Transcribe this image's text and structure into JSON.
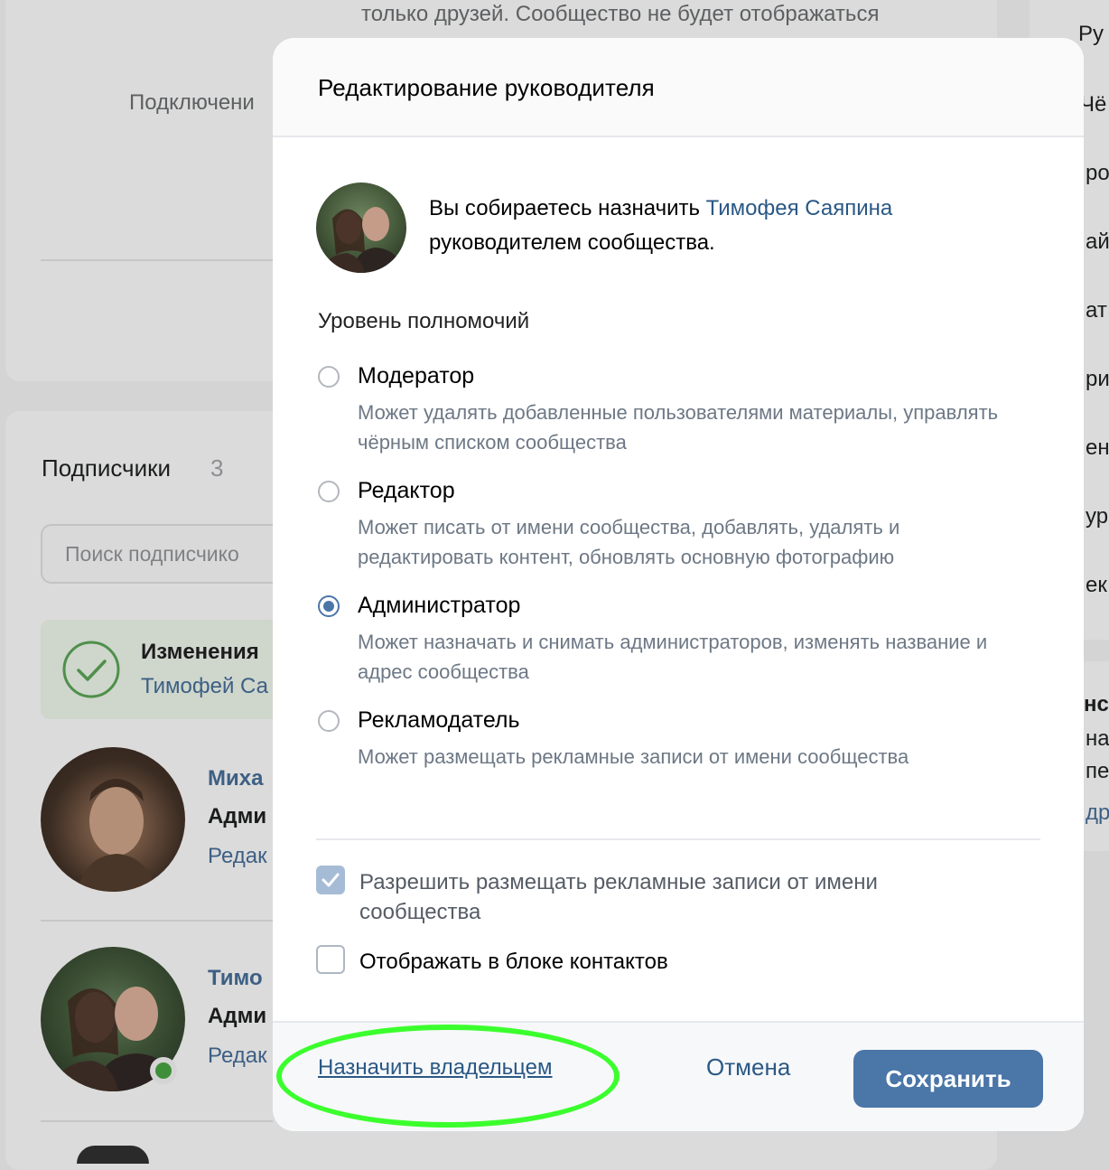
{
  "background": {
    "top_text": "только друзей. Сообщество не будет отображаться",
    "connect_label": "Подключени",
    "subscribers_title": "Подписчики",
    "subscribers_count": "3",
    "search_placeholder": "Поиск подписчико",
    "notice_title": "Изменения",
    "notice_name": "Тимофей Са",
    "members": [
      {
        "name": "Миха",
        "role": "Адми",
        "action": "Редак"
      },
      {
        "name": "Тимо",
        "role": "Адми",
        "action": "Редак"
      }
    ],
    "right_fragments": [
      "Ру",
      "Чё",
      "ро",
      "ай",
      "ат",
      "ри",
      "ен",
      "ур",
      "ек",
      "нс",
      "на",
      "пе",
      "др"
    ]
  },
  "modal": {
    "title": "Редактирование руководителя",
    "intro_prefix": "Вы собираетесь назначить ",
    "intro_name": "Тимофея Саяпина",
    "intro_suffix": "руководителем сообщества.",
    "permission_title": "Уровень полномочий",
    "options": [
      {
        "label": "Модератор",
        "desc": "Может удалять добавленные пользователями материалы, управлять чёрным списком сообщества",
        "checked": false
      },
      {
        "label": "Редактор",
        "desc": "Может писать от имени сообщества, добавлять, удалять и редактировать контент, обновлять основную фотографию",
        "checked": false
      },
      {
        "label": "Администратор",
        "desc": "Может назначать и снимать администраторов, изменять название и адрес сообщества",
        "checked": true
      },
      {
        "label": "Рекламодатель",
        "desc": "Может размещать рекламные записи от имени сообщества",
        "checked": false
      }
    ],
    "checkboxes": [
      {
        "label": "Разрешить размещать рекламные записи от имени сообщества",
        "checked": true,
        "disabled": true
      },
      {
        "label": "Отображать в блоке контактов",
        "checked": false,
        "disabled": false
      }
    ],
    "footer": {
      "owner_link": "Назначить владельцем",
      "cancel": "Отмена",
      "save": "Сохранить"
    }
  },
  "colors": {
    "accent": "#4a76a8",
    "link": "#2a5885",
    "highlight": "#3bff2d",
    "online": "#4bb34b"
  }
}
